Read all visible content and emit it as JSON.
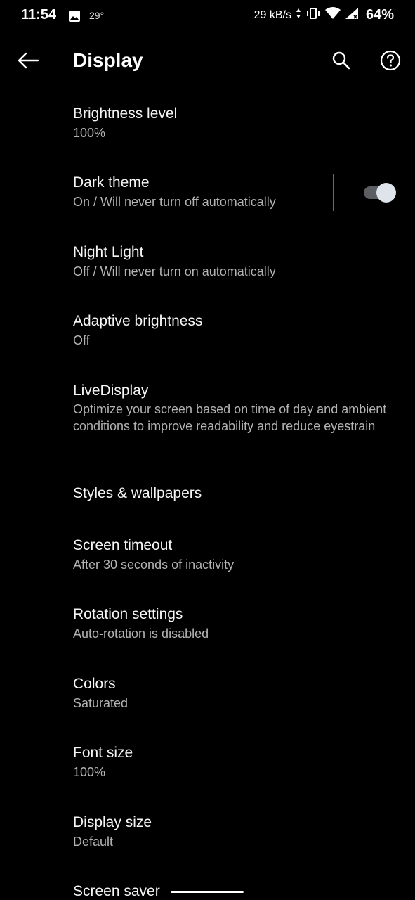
{
  "status_bar": {
    "time": "11:54",
    "temperature": "29°",
    "net_speed": "29 kB/s",
    "battery": "64%",
    "icons": [
      "image-icon",
      "data-arrows-icon",
      "vibrate-icon",
      "wifi-icon",
      "signal-icon"
    ]
  },
  "app_bar": {
    "title": "Display",
    "icons": [
      "back-arrow-icon",
      "search-icon",
      "help-icon"
    ]
  },
  "settings": [
    {
      "title": "Brightness level",
      "summary": "100%"
    },
    {
      "title": "Dark theme",
      "summary": "On / Will never turn off automatically",
      "toggle": true
    },
    {
      "title": "Night Light",
      "summary": "Off / Will never turn on automatically"
    },
    {
      "title": "Adaptive brightness",
      "summary": "Off"
    },
    {
      "title": "LiveDisplay",
      "summary": "Optimize your screen based on time of day and ambient conditions to improve readability and reduce eyestrain"
    },
    {
      "title": "Styles & wallpapers",
      "summary": ""
    },
    {
      "title": "Screen timeout",
      "summary": "After 30 seconds of inactivity"
    },
    {
      "title": "Rotation settings",
      "summary": "Auto-rotation is disabled"
    },
    {
      "title": "Colors",
      "summary": "Saturated"
    },
    {
      "title": "Font size",
      "summary": "100%"
    },
    {
      "title": "Display size",
      "summary": "Default"
    },
    {
      "title": "Screen saver",
      "summary": ""
    }
  ],
  "colors": {
    "background": "#000000",
    "title_text": "#f5f5f5",
    "summary_text": "#b3b3b3",
    "toggle_thumb": "#dfe4ea",
    "toggle_track": "#5b5f63"
  }
}
